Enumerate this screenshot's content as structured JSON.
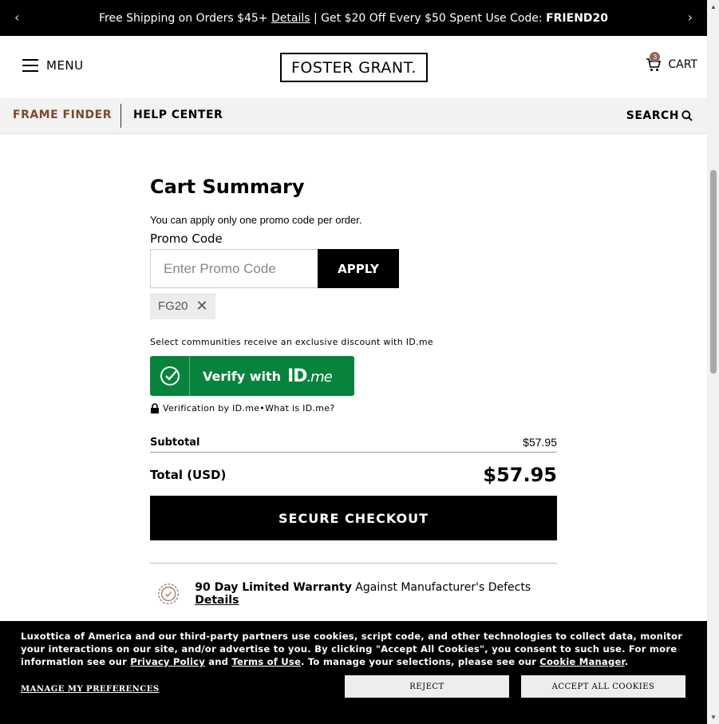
{
  "promo_bar": {
    "text_before": "Free Shipping on Orders $45+ ",
    "details_link": "Details",
    "text_middle": " | Get $20 Off Every $50 Spent Use Code: ",
    "code": "FRIEND20",
    "prev_icon": "chevron-left-icon",
    "next_icon": "chevron-right-icon"
  },
  "header": {
    "menu_label": "MENU",
    "logo": "FOSTER GRANT.",
    "cart_label": "CART",
    "cart_count": "3"
  },
  "subnav": {
    "frame_finder": "FRAME FINDER",
    "help_center": "HELP CENTER",
    "search_label": "SEARCH"
  },
  "cart_summary": {
    "title": "Cart Summary",
    "promo_note": "You can apply only one promo code per order.",
    "promo_label": "Promo Code",
    "promo_placeholder": "Enter Promo Code",
    "apply_label": "APPLY",
    "applied_code": "FG20",
    "idme_note": "Select communities receive an exclusive discount with ID.me",
    "idme_verify_text": "Verify with",
    "idme_brand": "ID",
    "idme_brand_suffix": ".me",
    "verification_by": "Verification by ID.me",
    "bullet": " • ",
    "what_is": "What is ID.me?",
    "subtotal_label": "Subtotal",
    "subtotal_value": "$57.95",
    "total_label": "Total (USD)",
    "total_value": "$57.95",
    "checkout_label": "SECURE CHECKOUT",
    "warranty_bold": "90 Day Limited Warranty",
    "warranty_text": " Against Manufacturer's Defects ",
    "warranty_link": "Details"
  },
  "cookie_banner": {
    "text_1": "Luxottica of America and our third-party partners use cookies, script code, and other technologies to collect data, monitor your interactions on our site, and/or advertise to you. By clicking \"Accept All Cookies\", you consent to such use. For more information see our ",
    "privacy_link": "Privacy Policy",
    "text_2": " and ",
    "terms_link": "Terms of Use",
    "text_3": ". To manage your selections, please see our ",
    "cookie_manager_link": "Cookie Manager",
    "text_4": ".",
    "manage_label": "MANAGE MY PREFERENCES",
    "reject_label": "REJECT",
    "accept_label": "ACCEPT ALL COOKIES"
  },
  "colors": {
    "frame_finder": "#7b4a2e",
    "idme_green": "#08833d",
    "cart_badge": "#8a6b5c"
  }
}
